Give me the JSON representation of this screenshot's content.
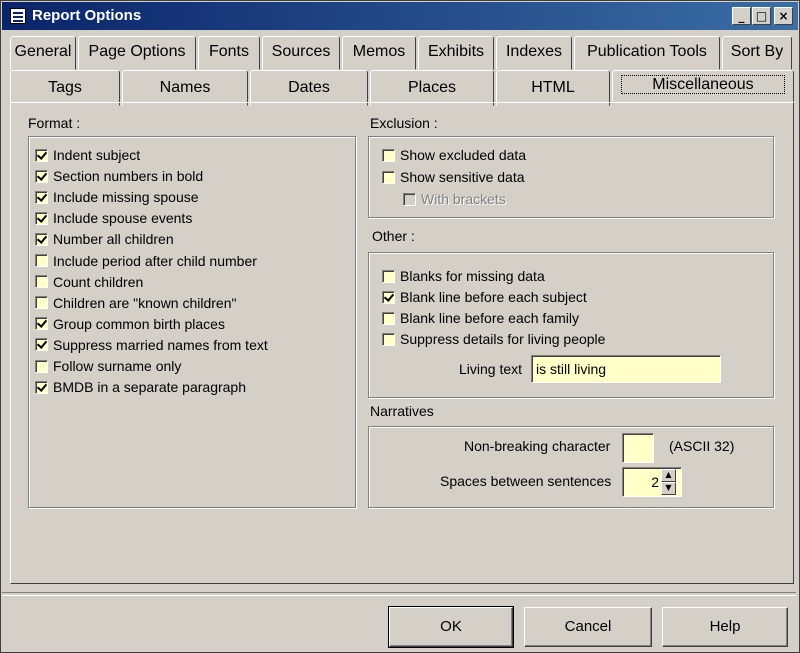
{
  "window": {
    "title": "Report Options"
  },
  "title_buttons": {
    "minimize": "_",
    "maximize": "□",
    "close": "×"
  },
  "tabs_row1": [
    "General",
    "Page Options",
    "Fonts",
    "Sources",
    "Memos",
    "Exhibits",
    "Indexes",
    "Publication Tools",
    "Sort By"
  ],
  "tabs_row2": [
    "Tags",
    "Names",
    "Dates",
    "Places",
    "HTML",
    "Miscellaneous"
  ],
  "format": {
    "label": "Format :",
    "items": [
      {
        "label": "Indent subject",
        "checked": true
      },
      {
        "label": "Section numbers in bold",
        "checked": true
      },
      {
        "label": "Include missing spouse",
        "checked": true
      },
      {
        "label": "Include spouse events",
        "checked": true
      },
      {
        "label": "Number all children",
        "checked": true
      },
      {
        "label": "Include period after child number",
        "checked": false
      },
      {
        "label": "Count children",
        "checked": false
      },
      {
        "label": "Children are \"known children\"",
        "checked": false
      },
      {
        "label": "Group common birth places",
        "checked": true
      },
      {
        "label": "Suppress married names from text",
        "checked": true
      },
      {
        "label": "Follow surname only",
        "checked": false
      },
      {
        "label": "BMDB in a separate paragraph",
        "checked": true
      }
    ]
  },
  "exclusion": {
    "label": "Exclusion :",
    "items": [
      {
        "label": "Show excluded data",
        "checked": false
      },
      {
        "label": "Show sensitive data",
        "checked": false
      },
      {
        "label": "With brackets",
        "checked": false,
        "disabled": true
      }
    ]
  },
  "other": {
    "label": "Other :",
    "items": [
      {
        "label": "Blanks for missing data",
        "checked": false
      },
      {
        "label": "Blank line before each subject",
        "checked": true
      },
      {
        "label": "Blank line before each family",
        "checked": false
      },
      {
        "label": "Suppress details for living people",
        "checked": false
      }
    ],
    "living_text_label": "Living text",
    "living_text_value": "is still living"
  },
  "narratives": {
    "label": "Narratives",
    "nbsp_label": "Non-breaking character",
    "nbsp_value": "",
    "ascii_note": "(ASCII 32)",
    "spaces_label": "Spaces between sentences",
    "spaces_value": "2"
  },
  "buttons": {
    "ok": "OK",
    "cancel": "Cancel",
    "help": "Help"
  }
}
